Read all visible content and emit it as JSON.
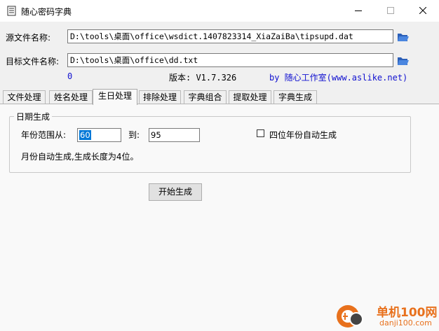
{
  "window": {
    "title": "随心密码字典"
  },
  "source": {
    "label": "源文件名称:",
    "value": "D:\\tools\\桌面\\office\\wsdict.1407823314_XiaZaiBa\\tipsupd.dat"
  },
  "target": {
    "label": "目标文件名称:",
    "value": "D:\\tools\\桌面\\office\\dd.txt"
  },
  "info": {
    "count": "0",
    "version": "版本: V1.7.326",
    "author": "by 随心工作室(www.aslike.net)"
  },
  "tabs": [
    {
      "label": "文件处理",
      "active": false
    },
    {
      "label": "姓名处理",
      "active": false
    },
    {
      "label": "生日处理",
      "active": true
    },
    {
      "label": "排除处理",
      "active": false
    },
    {
      "label": "字典组合",
      "active": false
    },
    {
      "label": "提取处理",
      "active": false
    },
    {
      "label": "字典生成",
      "active": false
    }
  ],
  "birthday": {
    "group_title": "日期生成",
    "year_from_label": "年份范围从:",
    "year_from": "60",
    "year_to_label": "到:",
    "year_to": "95",
    "four_digit_label": "四位年份自动生成",
    "four_digit_checked": false,
    "note": "月份自动生成,生成长度为4位。",
    "start_button": "开始生成"
  },
  "watermark": {
    "brand": "单机100网",
    "url": "danji100.com"
  }
}
